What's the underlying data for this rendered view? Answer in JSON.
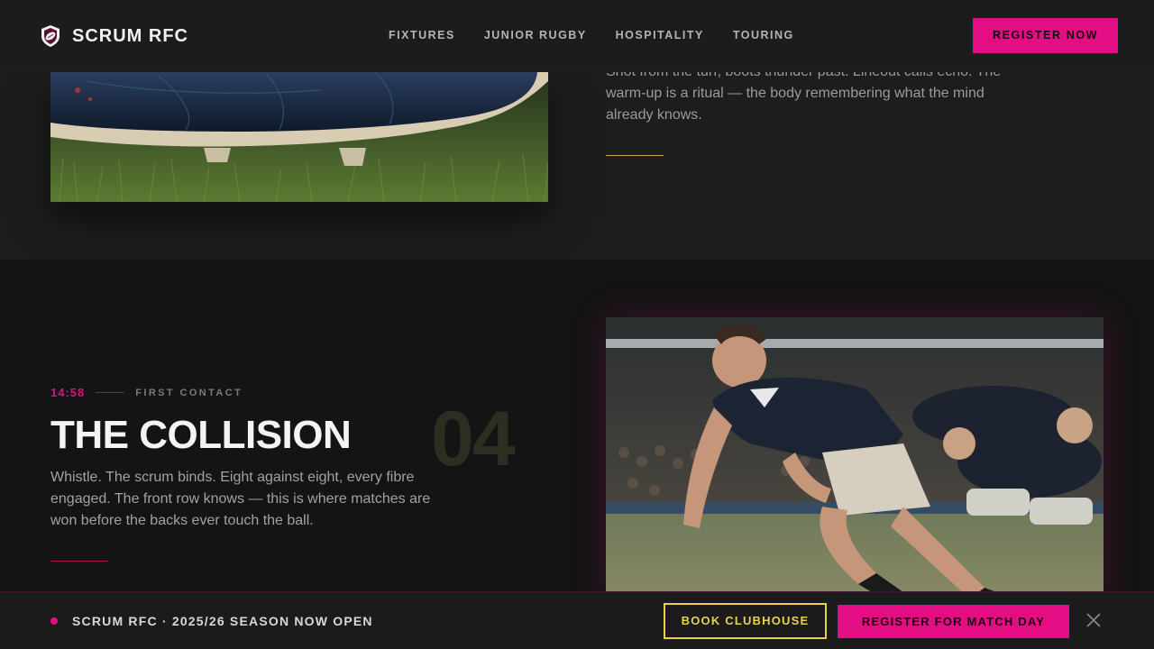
{
  "header": {
    "brand_name": "SCRUM RFC",
    "nav": [
      "FIXTURES",
      "JUNIOR RUGBY",
      "HOSPITALITY",
      "TOURING"
    ],
    "register_label": "REGISTER NOW"
  },
  "intro": {
    "body": "Shot from the turf, boots thunder past. Lineout calls echo. The warm-up is a ritual — the body remembering what the mind already knows."
  },
  "chapter": {
    "time": "14:58",
    "label": "FIRST CONTACT",
    "number": "04",
    "title": "THE COLLISION",
    "body": "Whistle. The scrum binds. Eight against eight, every fibre engaged. The front row knows — this is where matches are won before the backs ever touch the ball."
  },
  "sticky_bar": {
    "text": "SCRUM RFC · 2025/26 SEASON NOW OPEN",
    "book_label": "BOOK CLUBHOUSE",
    "register_label": "REGISTER FOR MATCH DAY"
  },
  "colors": {
    "accent_pink": "#e30d84",
    "accent_gold": "#e8d14c",
    "background": "#141414"
  },
  "icons": {
    "brand": "rugby-crest-icon",
    "close": "close-icon"
  }
}
